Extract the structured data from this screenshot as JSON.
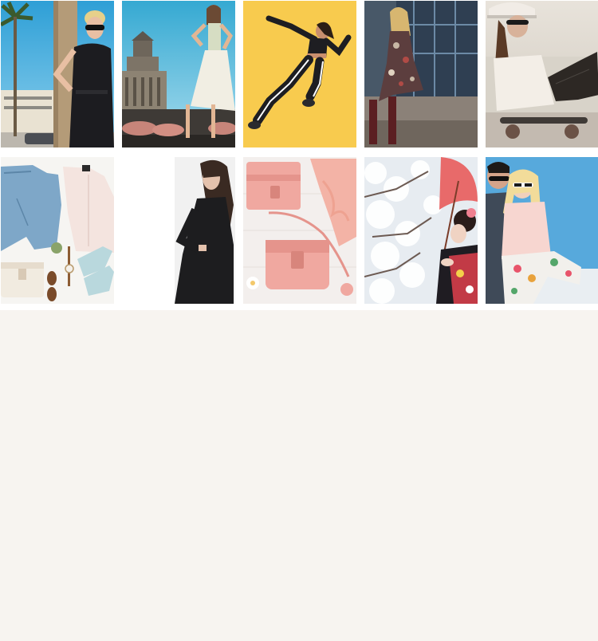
{
  "gallery": {
    "rows": [
      {
        "tiles": [
          {
            "subject": "woman-sunglasses-black-jumpsuit-palm-tree"
          },
          {
            "subject": "woman-white-skirt-rooftop-dome-building"
          },
          {
            "subject": "woman-running-black-sportswear-yellow-background"
          },
          {
            "subject": "woman-floral-dress-boots-street"
          },
          {
            "subject": "woman-cap-skateboard-beach"
          }
        ]
      },
      {
        "tiles": [
          {
            "subject": "flat-lay-jeans-shirt-bag-shoes"
          },
          {
            "subject": "woman-black-outfit-white-background"
          },
          {
            "subject": "pink-leather-bags-flat-lay"
          },
          {
            "subject": "woman-kimono-red-parasol-cherry-blossoms"
          },
          {
            "subject": "couple-sunglasses-floral-pants-blue-wall"
          }
        ]
      }
    ]
  },
  "colors": {
    "page_background": "#f7f4f0",
    "gallery_background": "#ffffff"
  }
}
